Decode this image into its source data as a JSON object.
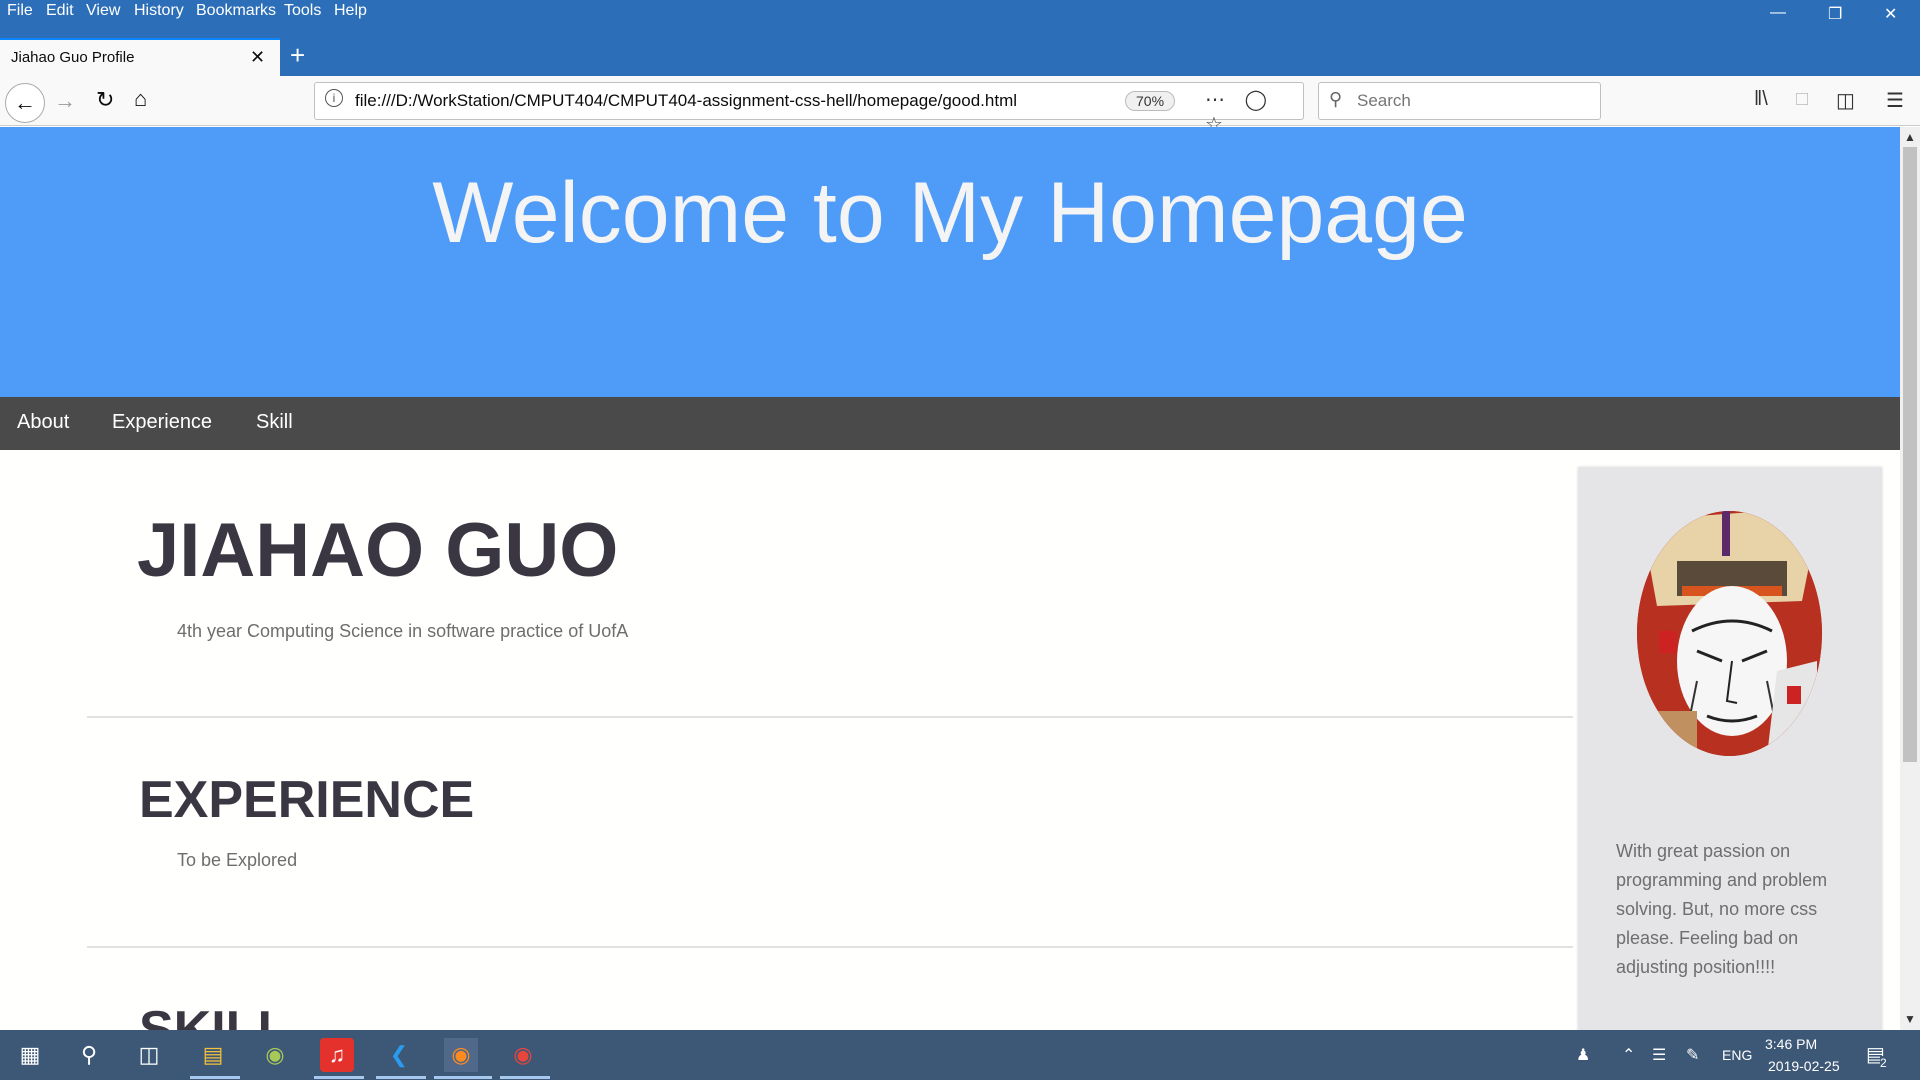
{
  "browser": {
    "menu": [
      "File",
      "Edit",
      "View",
      "History",
      "Bookmarks",
      "Tools",
      "Help"
    ],
    "tab_title": "Jiahao Guo Profile",
    "url": "file:///D:/WorkStation/CMPUT404/CMPUT404-assignment-css-hell/homepage/good.html",
    "zoom": "70%",
    "search_placeholder": "Search"
  },
  "page": {
    "banner_title": "Welcome to My Homepage",
    "nav": [
      "About",
      "Experience",
      "Skill"
    ],
    "name": "JIAHAO GUO",
    "subtitle": "4th year Computing Science in software practice of UofA",
    "experience_heading": "EXPERIENCE",
    "experience_text": "To be Explored",
    "skill_heading": "SKILL",
    "bio": "With great passion on programming and problem solving. But, no more css please. Feeling bad on adjusting position!!!!"
  },
  "colors": {
    "banner": "#4f9bf8",
    "nav_bar": "#4a4a4a",
    "chrome": "#2c6fb8",
    "taskbar": "#3d5877"
  },
  "taskbar": {
    "time": "3:46 PM",
    "date": "2019-02-25",
    "language": "ENG",
    "notification_count": "2"
  }
}
